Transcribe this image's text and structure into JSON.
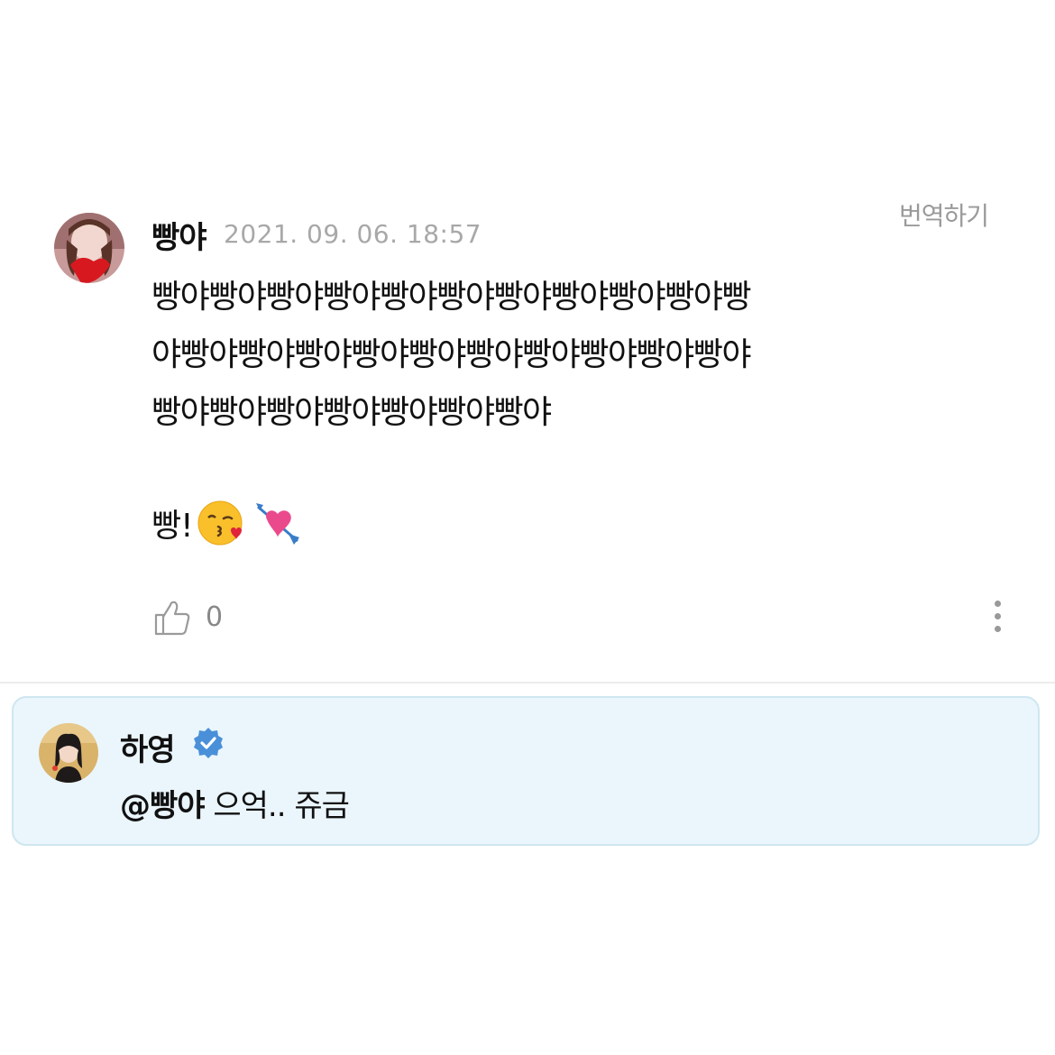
{
  "comment": {
    "username": "빵야",
    "timestamp": "2021. 09. 06. 18:57",
    "translate_label": "번역하기",
    "body_lines": [
      "빵야빵야빵야빵야빵야빵야빵야빵야빵야빵야빵",
      "야빵야빵야빵야빵야빵야빵야빵야빵야빵야빵야",
      "빵야빵야빵야빵야빵야빵야빵야"
    ],
    "exclaim": "빵!",
    "emojis": [
      "kissing-face-with-heart-emoji",
      "heart-with-arrow-emoji"
    ],
    "like_count": "0",
    "avatar_icon": "profile-avatar",
    "like_icon": "thumbs-up-icon",
    "more_icon": "vertical-ellipsis-icon"
  },
  "reply": {
    "username": "하영",
    "mention": "@빵야",
    "text": " 으억.. 쥬금",
    "verified_icon": "verified-badge-icon",
    "background_color": "#eaf6fc",
    "badge_color": "#4a90d9"
  }
}
